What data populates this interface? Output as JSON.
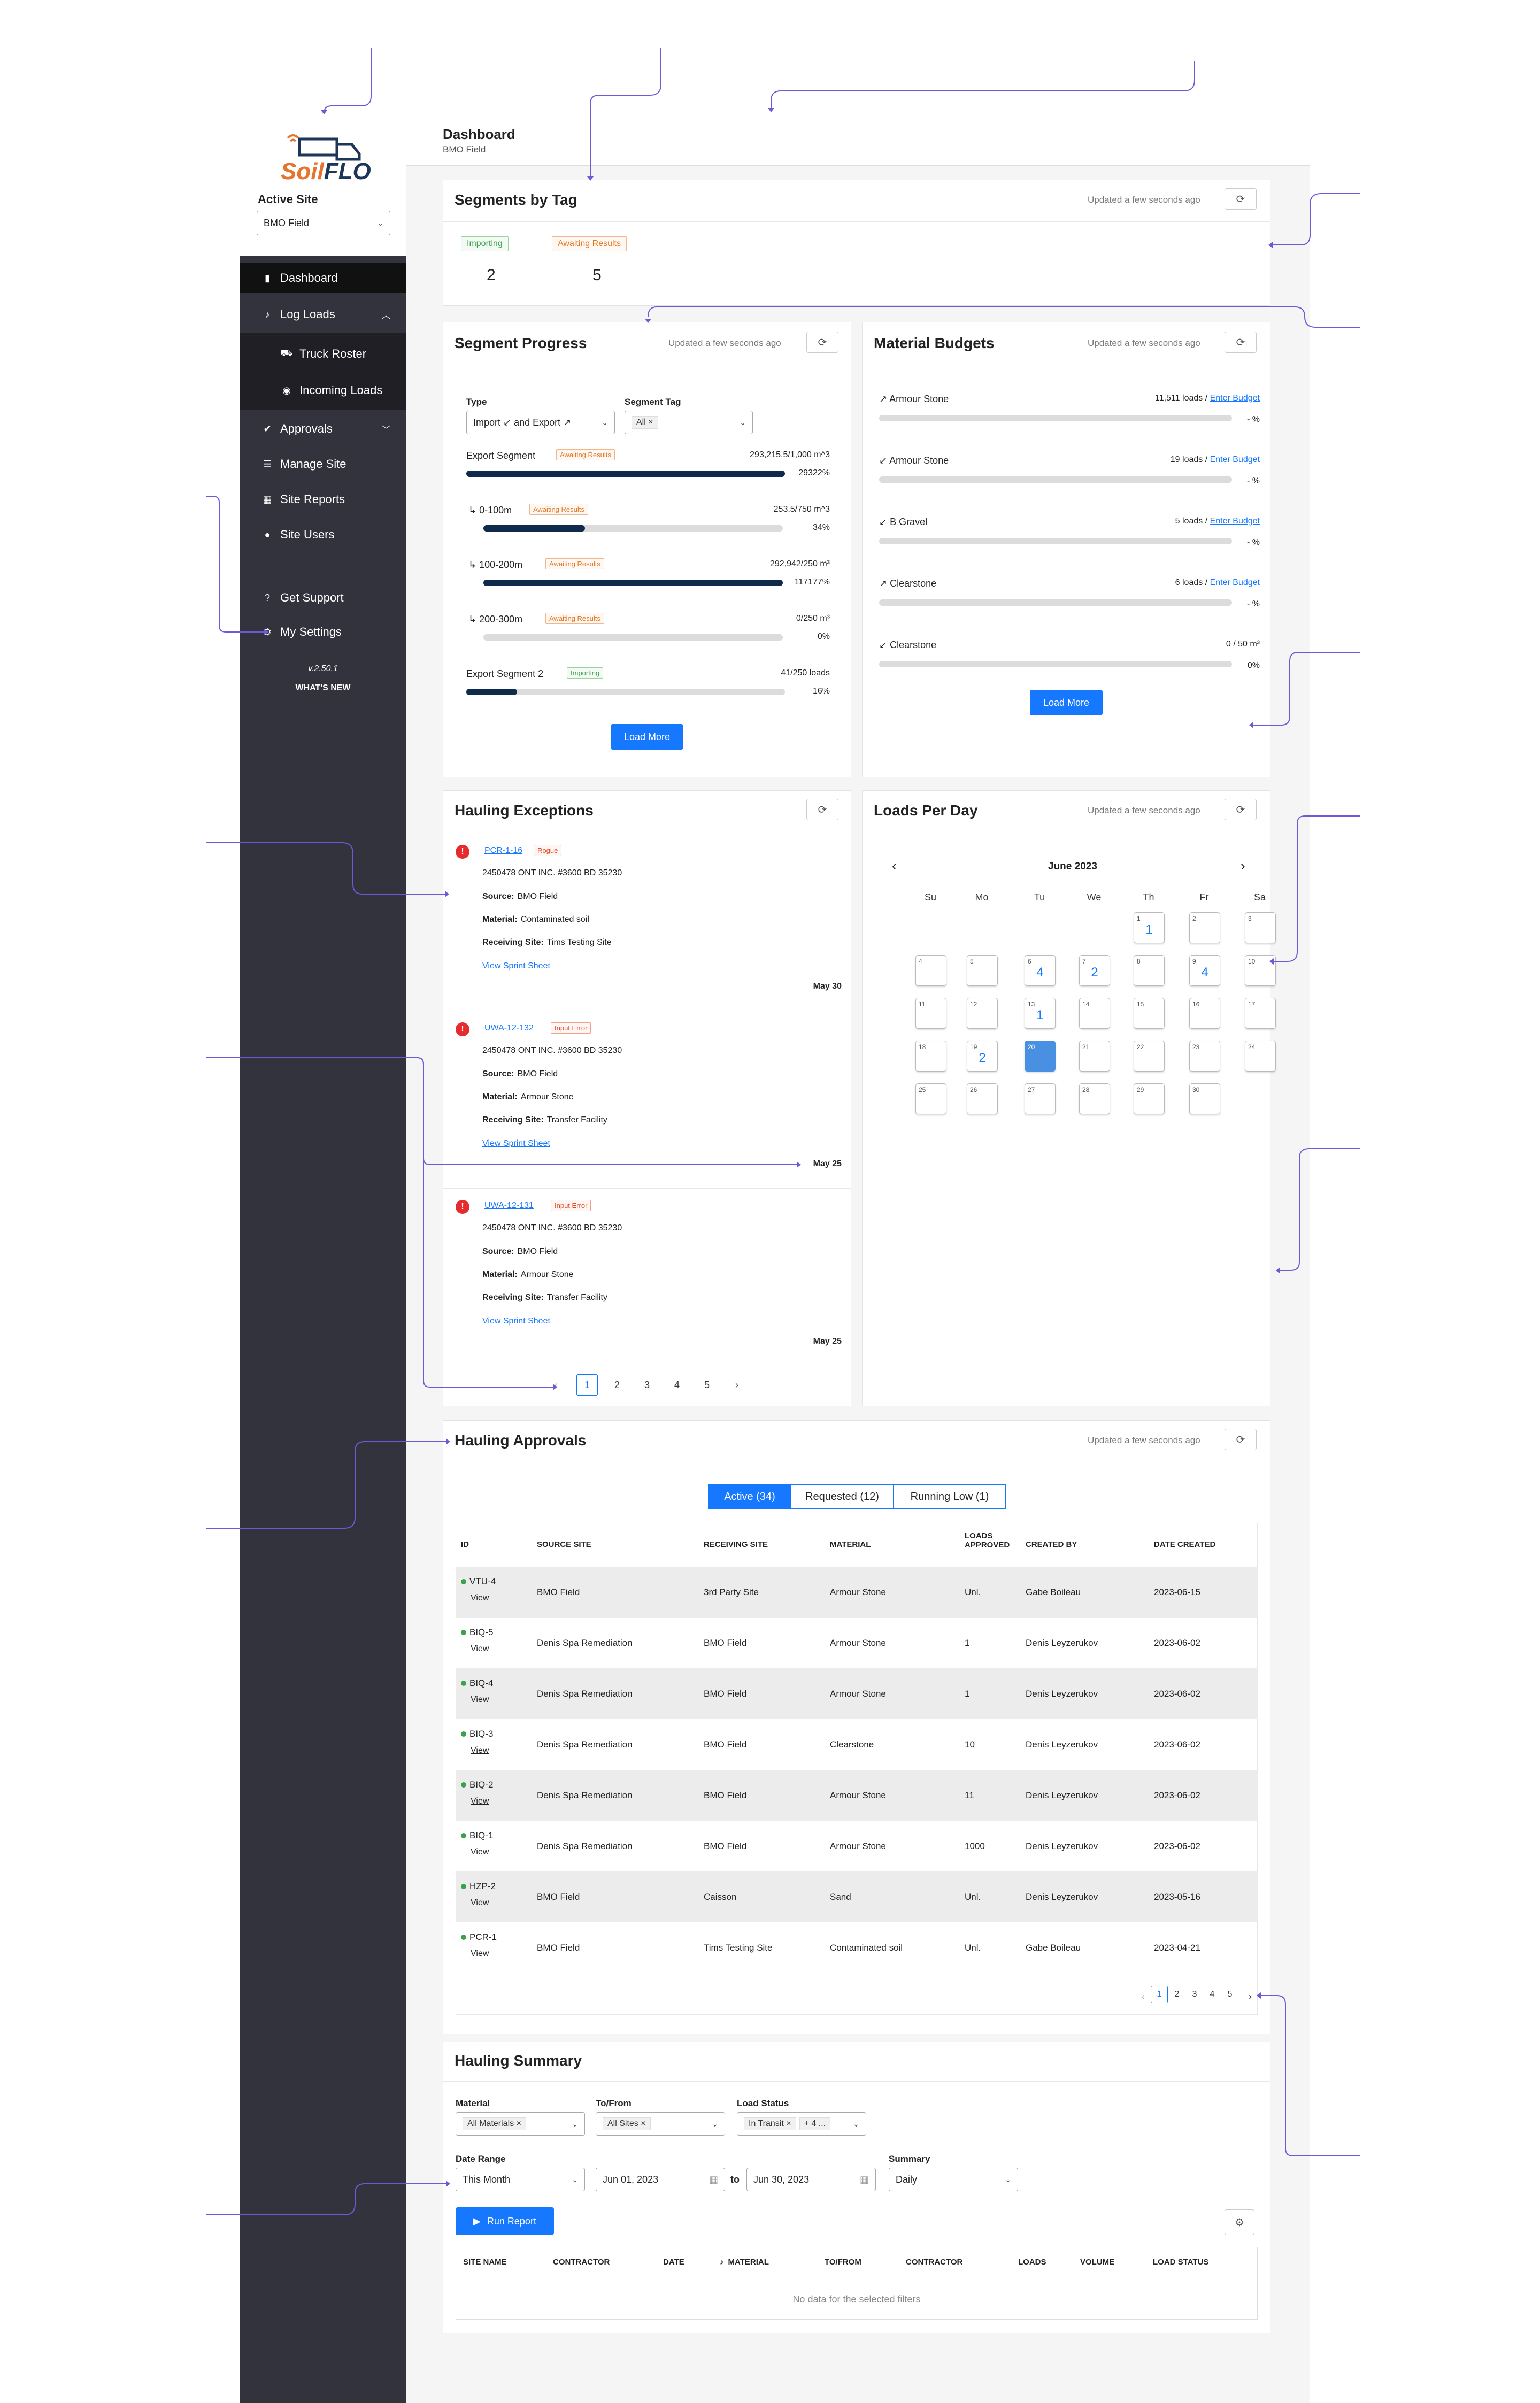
{
  "app": {
    "brand_soil": "Soil",
    "brand_flo": "FLO",
    "active_site_label": "Active Site",
    "active_site_value": "BMO Field",
    "version": "v.2.50.1",
    "whats_new": "WHAT'S NEW"
  },
  "sidebar": {
    "items": [
      {
        "label": "Dashboard",
        "icon": "bar-chart-icon"
      },
      {
        "label": "Log Loads",
        "icon": "music-note-icon"
      },
      {
        "label": "Truck Roster",
        "icon": "truck-icon"
      },
      {
        "label": "Incoming Loads",
        "icon": "coin-icon"
      },
      {
        "label": "Approvals",
        "icon": "check-circle-icon"
      },
      {
        "label": "Manage Site",
        "icon": "sliders-icon"
      },
      {
        "label": "Site Reports",
        "icon": "table-icon"
      },
      {
        "label": "Site Users",
        "icon": "user-icon"
      },
      {
        "label": "Get Support",
        "icon": "help-icon"
      },
      {
        "label": "My Settings",
        "icon": "gear-icon"
      }
    ]
  },
  "header": {
    "title": "Dashboard",
    "subtitle": "BMO Field"
  },
  "segments_by_tag": {
    "title": "Segments by Tag",
    "updated": "Updated a few seconds ago",
    "tags": [
      {
        "label": "Importing",
        "value": "2"
      },
      {
        "label": "Awaiting Results",
        "value": "5"
      }
    ]
  },
  "segment_progress": {
    "title": "Segment Progress",
    "updated": "Updated a few seconds ago",
    "type_label": "Type",
    "type_value": "Import ↙ and Export ↗",
    "tag_label": "Segment Tag",
    "tag_value": "All",
    "rows": [
      {
        "name": "Export Segment",
        "badge": "Awaiting Results",
        "amount": "293,215.5/1,000 m^3",
        "pct": "29322%",
        "fill": 1.0
      },
      {
        "name": "↳ 0-100m",
        "badge": "Awaiting Results",
        "amount": "253.5/750 m^3",
        "pct": "34%",
        "fill": 0.34
      },
      {
        "name": "↳ 100-200m",
        "badge": "Awaiting Results",
        "amount": "292,942/250 m³",
        "pct": "117177%",
        "fill": 1.0
      },
      {
        "name": "↳ 200-300m",
        "badge": "Awaiting Results",
        "amount": "0/250 m³",
        "pct": "0%",
        "fill": 0
      },
      {
        "name": "Export Segment 2",
        "badge": "Importing",
        "amount": "41/250 loads",
        "pct": "16%",
        "fill": 0.16
      }
    ],
    "load_more": "Load More"
  },
  "material_budgets": {
    "title": "Material Budgets",
    "updated": "Updated a few seconds ago",
    "rows": [
      {
        "name": "↗ Armour Stone",
        "loads": "11,511 loads / ",
        "link": "Enter Budget",
        "pct": "- %"
      },
      {
        "name": "↙ Armour Stone",
        "loads": "19 loads / ",
        "link": "Enter Budget",
        "pct": "- %"
      },
      {
        "name": "↙ B Gravel",
        "loads": "5 loads / ",
        "link": "Enter Budget",
        "pct": "- %"
      },
      {
        "name": "↗ Clearstone",
        "loads": "6 loads / ",
        "link": "Enter Budget",
        "pct": "- %"
      },
      {
        "name": "↙ Clearstone",
        "loads": "0 / 50 m³",
        "link": "",
        "pct": "0%"
      }
    ],
    "load_more": "Load More"
  },
  "hauling_exceptions": {
    "title": "Hauling Exceptions",
    "items": [
      {
        "id": "PCR-1-16",
        "badge": "Rogue",
        "company": "2450478 ONT INC. #3600 BD 35230",
        "source_label": "Source:",
        "source": "BMO Field",
        "material_label": "Material:",
        "material": "Contaminated soil",
        "receiving_label": "Receiving Site:",
        "receiving": "Tims Testing Site",
        "link": "View Sprint Sheet",
        "date": "May 30"
      },
      {
        "id": "UWA-12-132",
        "badge": "Input Error",
        "company": "2450478 ONT INC. #3600 BD 35230",
        "source_label": "Source:",
        "source": "BMO Field",
        "material_label": "Material:",
        "material": "Armour Stone",
        "receiving_label": "Receiving Site:",
        "receiving": "Transfer Facility",
        "link": "View Sprint Sheet",
        "date": "May 25"
      },
      {
        "id": "UWA-12-131",
        "badge": "Input Error",
        "company": "2450478 ONT INC. #3600 BD 35230",
        "source_label": "Source:",
        "source": "BMO Field",
        "material_label": "Material:",
        "material": "Armour Stone",
        "receiving_label": "Receiving Site:",
        "receiving": "Transfer Facility",
        "link": "View Sprint Sheet",
        "date": "May 25"
      }
    ],
    "pages": [
      "1",
      "2",
      "3",
      "4",
      "5"
    ]
  },
  "loads_per_day": {
    "title": "Loads Per Day",
    "updated": "Updated a few seconds ago",
    "month": "June 2023",
    "weekdays": [
      "Su",
      "Mo",
      "Tu",
      "We",
      "Th",
      "Fr",
      "Sa"
    ],
    "counts": {
      "1": "1",
      "6": "4",
      "7": "2",
      "9": "4",
      "13": "1",
      "19": "2"
    },
    "today": "20"
  },
  "hauling_approvals": {
    "title": "Hauling Approvals",
    "updated": "Updated a few seconds ago",
    "tabs": [
      "Active (34)",
      "Requested (12)",
      "Running Low (1)"
    ],
    "columns": [
      "ID",
      "SOURCE SITE",
      "RECEIVING SITE",
      "MATERIAL",
      "LOADS APPROVED",
      "CREATED BY",
      "DATE CREATED"
    ],
    "view_label": "View",
    "rows": [
      [
        "VTU-4",
        "BMO Field",
        "3rd Party Site",
        "Armour Stone",
        "Unl.",
        "Gabe Boileau",
        "2023-06-15"
      ],
      [
        "BIQ-5",
        "Denis Spa Remediation",
        "BMO Field",
        "Armour Stone",
        "1",
        "Denis Leyzerukov",
        "2023-06-02"
      ],
      [
        "BIQ-4",
        "Denis Spa Remediation",
        "BMO Field",
        "Armour Stone",
        "1",
        "Denis Leyzerukov",
        "2023-06-02"
      ],
      [
        "BIQ-3",
        "Denis Spa Remediation",
        "BMO Field",
        "Clearstone",
        "10",
        "Denis Leyzerukov",
        "2023-06-02"
      ],
      [
        "BIQ-2",
        "Denis Spa Remediation",
        "BMO Field",
        "Armour Stone",
        "11",
        "Denis Leyzerukov",
        "2023-06-02"
      ],
      [
        "BIQ-1",
        "Denis Spa Remediation",
        "BMO Field",
        "Armour Stone",
        "1000",
        "Denis Leyzerukov",
        "2023-06-02"
      ],
      [
        "HZP-2",
        "BMO Field",
        "Caisson",
        "Sand",
        "Unl.",
        "Denis Leyzerukov",
        "2023-05-16"
      ],
      [
        "PCR-1",
        "BMO Field",
        "Tims Testing Site",
        "Contaminated soil",
        "Unl.",
        "Gabe Boileau",
        "2023-04-21"
      ]
    ],
    "pages": [
      "1",
      "2",
      "3",
      "4",
      "5"
    ]
  },
  "hauling_summary": {
    "title": "Hauling Summary",
    "material_label": "Material",
    "material_value": "All Materials",
    "tofrom_label": "To/From",
    "tofrom_value": "All Sites",
    "status_label": "Load Status",
    "status_value": "In Transit",
    "status_more": "+ 4 ...",
    "date_range_label": "Date Range",
    "date_range_value": "This Month",
    "date_from": "Jun 01, 2023",
    "to": "to",
    "date_to": "Jun 30, 2023",
    "summary_label": "Summary",
    "summary_value": "Daily",
    "run_report": "Run Report",
    "columns": [
      "SITE NAME",
      "CONTRACTOR",
      "DATE",
      "MATERIAL",
      "TO/FROM",
      "CONTRACTOR",
      "LOADS",
      "VOLUME",
      "LOAD STATUS"
    ],
    "empty": "No data for the selected filters"
  },
  "colors": {
    "accent": "#1677ff",
    "sidebar": "#32333c",
    "progress": "#102a4c",
    "annotation": "#6b5bd6"
  }
}
